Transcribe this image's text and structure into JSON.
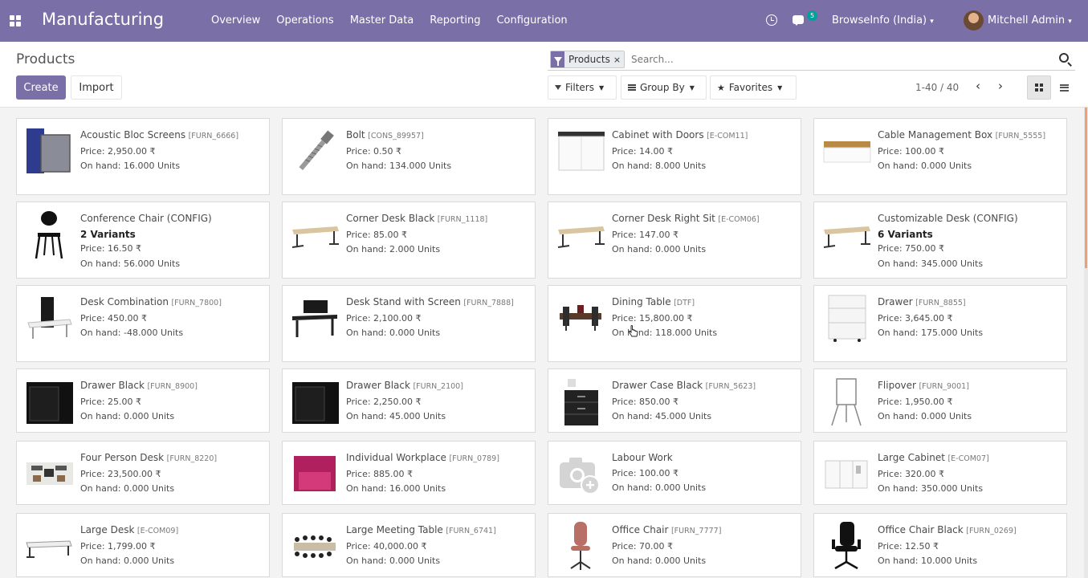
{
  "navbar": {
    "app_title": "Manufacturing",
    "menu": [
      "Overview",
      "Operations",
      "Master Data",
      "Reporting",
      "Configuration"
    ],
    "chat_count": "5",
    "company": "BrowseInfo (India)",
    "company_caret": "▾",
    "user": "Mitchell Admin",
    "user_caret": "▾",
    "accent_color": "#7b6fa8"
  },
  "control": {
    "breadcrumb": "Products",
    "create_label": "Create",
    "import_label": "Import",
    "facet_label": "Products",
    "facet_remove": "×",
    "search_placeholder": "Search...",
    "filters_label": "Filters",
    "groupby_label": "Group By",
    "favorites_label": "Favorites",
    "pager": "1-40 / 40",
    "prev": "‹",
    "next": "›"
  },
  "products": [
    {
      "name": "Acoustic Bloc Screens",
      "ref": "[FURN_6666]",
      "price": "Price: 2,950.00 ₹",
      "onhand": "On hand: 16.000 Units",
      "icon": "screens-icon"
    },
    {
      "name": "Bolt",
      "ref": "[CONS_89957]",
      "price": "Price: 0.50 ₹",
      "onhand": "On hand: 134.000 Units",
      "icon": "bolt-icon"
    },
    {
      "name": "Cabinet with Doors",
      "ref": "[E-COM11]",
      "price": "Price: 14.00 ₹",
      "onhand": "On hand: 8.000 Units",
      "icon": "cabinet-icon"
    },
    {
      "name": "Cable Management Box",
      "ref": "[FURN_5555]",
      "price": "Price: 100.00 ₹",
      "onhand": "On hand: 0.000 Units",
      "icon": "cable-box-icon"
    },
    {
      "name": "Conference Chair (CONFIG)",
      "ref": "",
      "variants": "2 Variants",
      "price": "Price: 16.50 ₹",
      "onhand": "On hand: 56.000 Units",
      "icon": "chair-icon"
    },
    {
      "name": "Corner Desk Black",
      "ref": "[FURN_1118]",
      "price": "Price: 85.00 ₹",
      "onhand": "On hand: 2.000 Units",
      "icon": "desk-icon"
    },
    {
      "name": "Corner Desk Right Sit",
      "ref": "[E-COM06]",
      "price": "Price: 147.00 ₹",
      "onhand": "On hand: 0.000 Units",
      "icon": "desk-icon"
    },
    {
      "name": "Customizable Desk (CONFIG)",
      "ref": "",
      "variants": "6 Variants",
      "price": "Price: 750.00 ₹",
      "onhand": "On hand: 345.000 Units",
      "icon": "desk-icon"
    },
    {
      "name": "Desk Combination",
      "ref": "[FURN_7800]",
      "price": "Price: 450.00 ₹",
      "onhand": "On hand: -48.000 Units",
      "icon": "desk-combo-icon"
    },
    {
      "name": "Desk Stand with Screen",
      "ref": "[FURN_7888]",
      "price": "Price: 2,100.00 ₹",
      "onhand": "On hand: 0.000 Units",
      "icon": "desk-stand-icon"
    },
    {
      "name": "Dining Table",
      "ref": "[DTF]",
      "price": "Price: 15,800.00 ₹",
      "onhand": "On hand: 118.000 Units",
      "icon": "dining-table-icon"
    },
    {
      "name": "Drawer",
      "ref": "[FURN_8855]",
      "price": "Price: 3,645.00 ₹",
      "onhand": "On hand: 175.000 Units",
      "icon": "drawer-icon"
    },
    {
      "name": "Drawer Black",
      "ref": "[FURN_8900]",
      "price": "Price: 25.00 ₹",
      "onhand": "On hand: 0.000 Units",
      "icon": "drawer-black-icon"
    },
    {
      "name": "Drawer Black",
      "ref": "[FURN_2100]",
      "price": "Price: 2,250.00 ₹",
      "onhand": "On hand: 45.000 Units",
      "icon": "drawer-black-icon"
    },
    {
      "name": "Drawer Case Black",
      "ref": "[FURN_5623]",
      "price": "Price: 850.00 ₹",
      "onhand": "On hand: 45.000 Units",
      "icon": "drawer-case-icon"
    },
    {
      "name": "Flipover",
      "ref": "[FURN_9001]",
      "price": "Price: 1,950.00 ₹",
      "onhand": "On hand: 0.000 Units",
      "icon": "flipover-icon"
    },
    {
      "name": "Four Person Desk",
      "ref": "[FURN_8220]",
      "price": "Price: 23,500.00 ₹",
      "onhand": "On hand: 0.000 Units",
      "icon": "four-person-desk-icon"
    },
    {
      "name": "Individual Workplace",
      "ref": "[FURN_0789]",
      "price": "Price: 885.00 ₹",
      "onhand": "On hand: 16.000 Units",
      "icon": "workplace-icon"
    },
    {
      "name": "Labour Work",
      "ref": "",
      "price": "Price: 100.00 ₹",
      "onhand": "On hand: 0.000 Units",
      "icon": "camera-placeholder-icon"
    },
    {
      "name": "Large Cabinet",
      "ref": "[E-COM07]",
      "price": "Price: 320.00 ₹",
      "onhand": "On hand: 350.000 Units",
      "icon": "large-cabinet-icon"
    },
    {
      "name": "Large Desk",
      "ref": "[E-COM09]",
      "price": "Price: 1,799.00 ₹",
      "onhand": "On hand: 0.000 Units",
      "icon": "large-desk-icon"
    },
    {
      "name": "Large Meeting Table",
      "ref": "[FURN_6741]",
      "price": "Price: 40,000.00 ₹",
      "onhand": "On hand: 0.000 Units",
      "icon": "meeting-table-icon"
    },
    {
      "name": "Office Chair",
      "ref": "[FURN_7777]",
      "price": "Price: 70.00 ₹",
      "onhand": "On hand: 0.000 Units",
      "icon": "office-chair-icon"
    },
    {
      "name": "Office Chair Black",
      "ref": "[FURN_0269]",
      "price": "Price: 12.50 ₹",
      "onhand": "On hand: 10.000 Units",
      "icon": "office-chair-black-icon"
    }
  ]
}
